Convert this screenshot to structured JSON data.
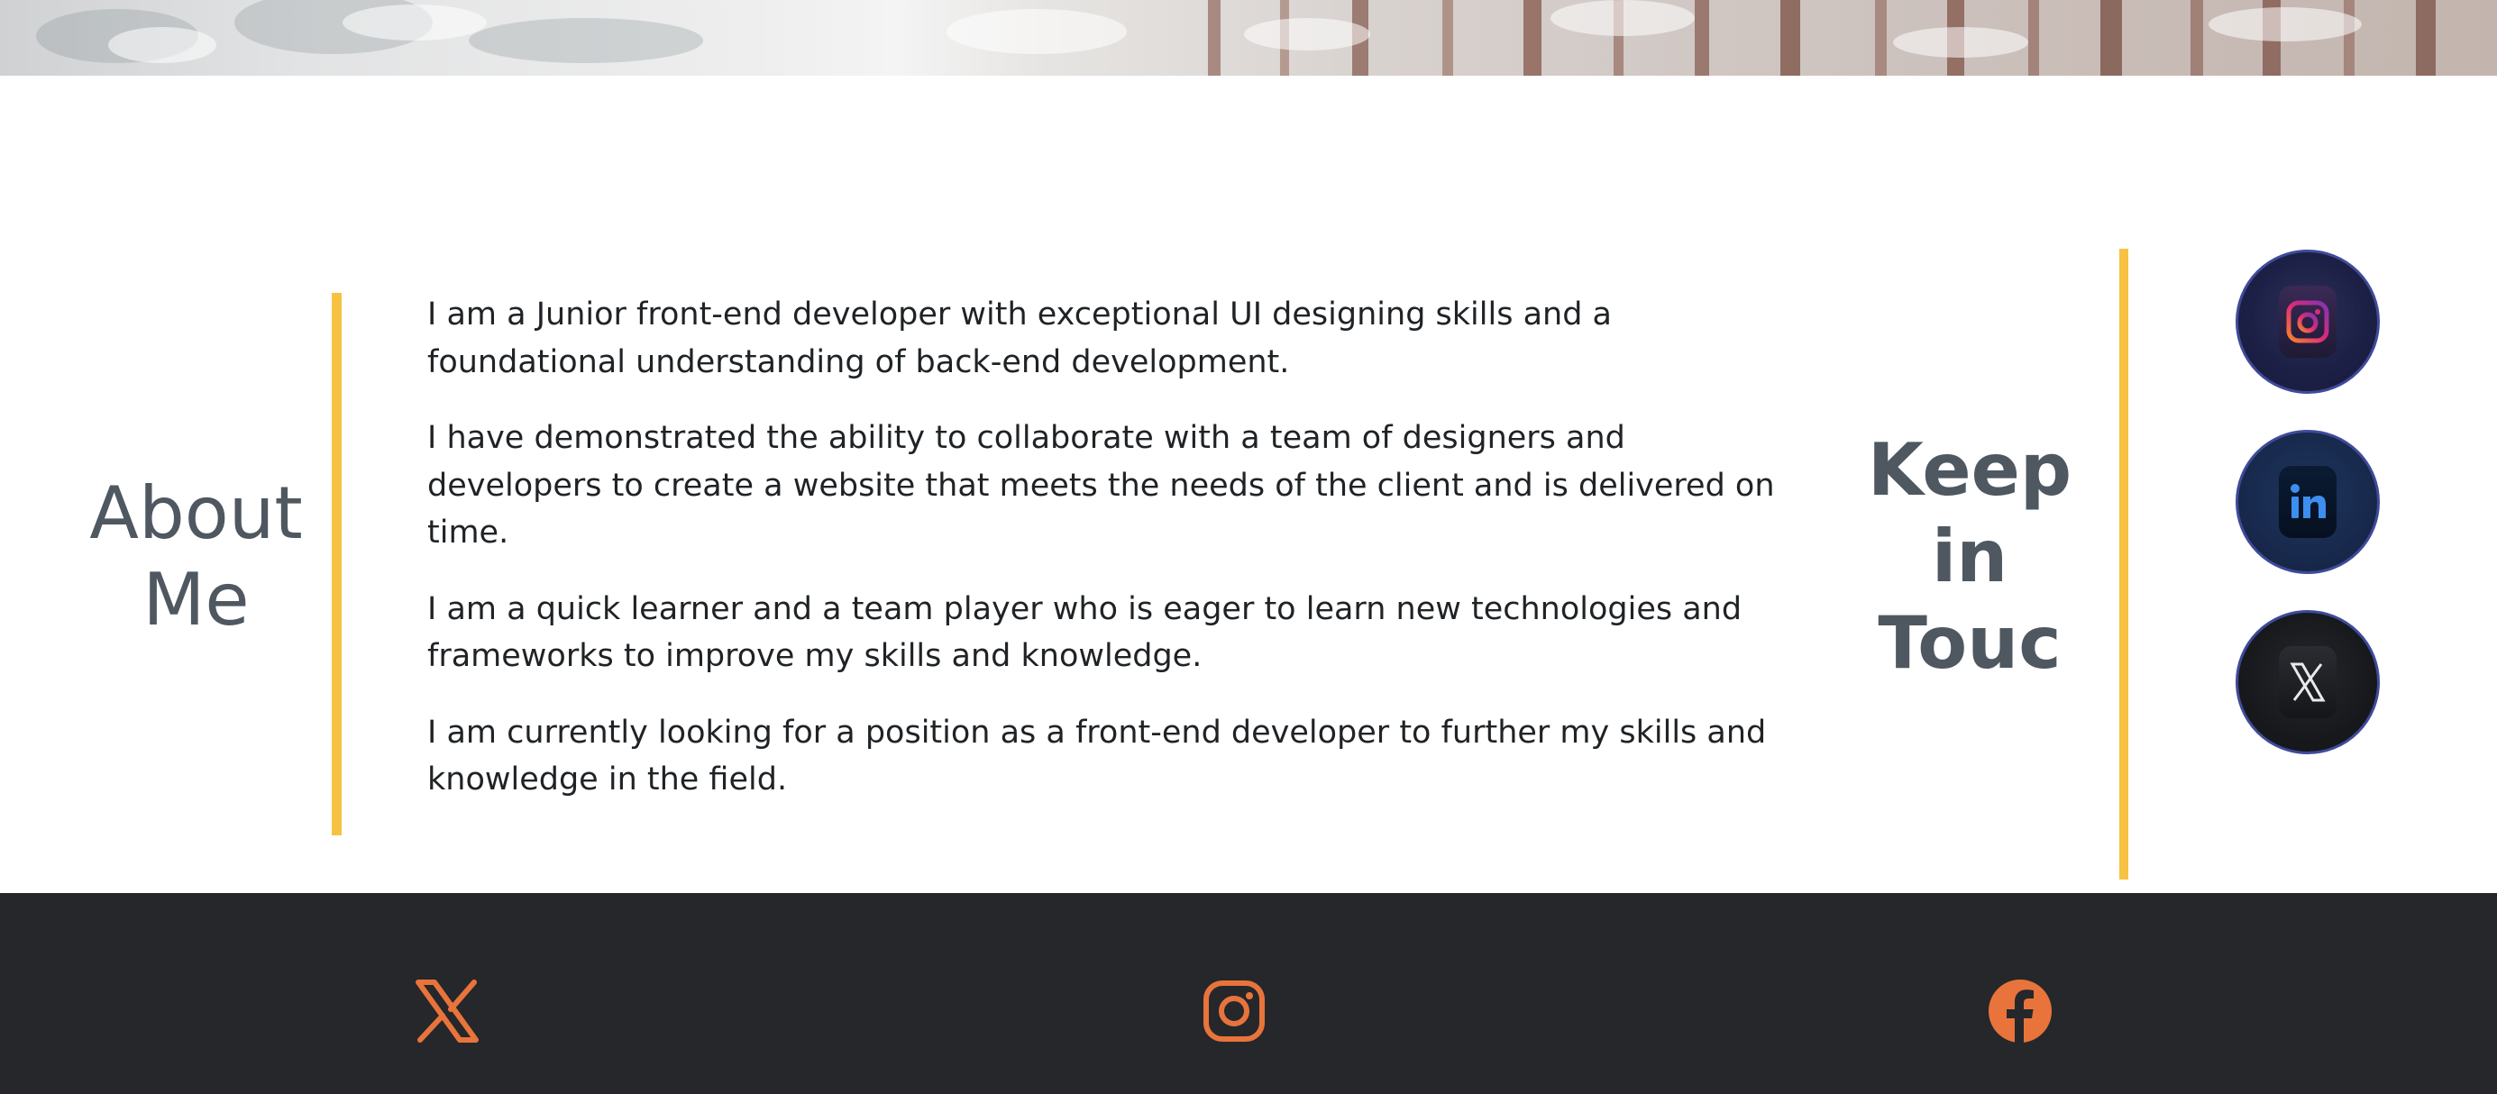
{
  "about": {
    "title": "About Me",
    "paragraphs": [
      "I am a Junior front-end developer with exceptional UI designing skills and a foundational understanding of back-end development.",
      "I have demonstrated the ability to collaborate with a team of designers and developers to create a website that meets the needs of the client and is delivered on time.",
      "I am a quick learner and a team player who is eager to learn new technologies and frameworks to improve my skills and knowledge.",
      "I am currently looking for a position as a front-end developer to further my skills and knowledge in the field."
    ]
  },
  "contact": {
    "title": "Keep in Touc",
    "links": [
      {
        "icon": "instagram-icon"
      },
      {
        "icon": "linkedin-icon"
      },
      {
        "icon": "x-icon"
      }
    ]
  },
  "footer": {
    "icons": [
      "x-icon",
      "instagram-icon",
      "facebook-icon"
    ],
    "icon_color": "#e8743b"
  },
  "colors": {
    "accent": "#f7c242",
    "heading": "#4f5860",
    "footer_bg": "#25272b"
  }
}
